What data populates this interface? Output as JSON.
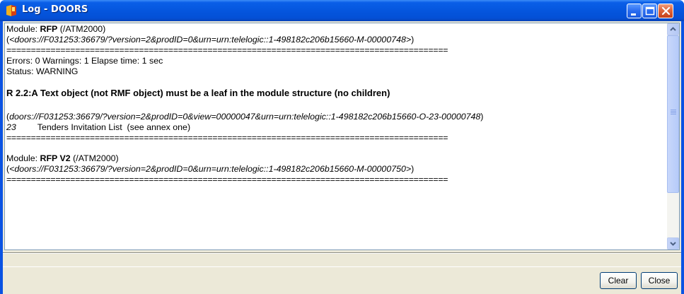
{
  "window": {
    "title": "Log - DOORS"
  },
  "log": {
    "module1_label": "Module: ",
    "module1_name": "RFP",
    "module1_path": " (/ATM2000)",
    "module1_url_open": "(",
    "module1_url": "<doors://F031253:36679/?version=2&prodID=0&urn=urn:telelogic::1-498182c206b15660-M-00000748>",
    "module1_url_close": ")",
    "separator": "==========================================================================================",
    "stats": "Errors: 0 Warnings: 1 Elapse time: 1 sec",
    "status": "Status: WARNING",
    "rule": "R 2.2:A Text object (not RMF object) must be a leaf in the module structure (no children)",
    "object_url_open": "(",
    "object_url": "doors://F031253:36679/?version=2&prodID=0&view=00000047&urn=urn:telelogic::1-498182c206b15660-O-23-00000748",
    "object_url_close": ")",
    "object_id": "23",
    "object_text": "Tenders Invitation List  (see annex one)",
    "module2_label": "Module: ",
    "module2_name": "RFP V2",
    "module2_path": " (/ATM2000)",
    "module2_url_open": "(",
    "module2_url": "<doors://F031253:36679/?version=2&prodID=0&urn=urn:telelogic::1-498182c206b15660-M-00000750>",
    "module2_url_close": ")"
  },
  "buttons": {
    "clear": "Clear",
    "close": "Close"
  },
  "icons": {
    "app": "doors-app-icon",
    "minimize": "minimize-icon",
    "maximize": "maximize-icon",
    "close": "close-icon",
    "scroll_up": "scroll-up-arrow-icon",
    "scroll_down": "scroll-down-arrow-icon"
  },
  "colors": {
    "titlebar": "#0556de",
    "close_button": "#c4401a",
    "client_bg": "#ece9d8"
  }
}
